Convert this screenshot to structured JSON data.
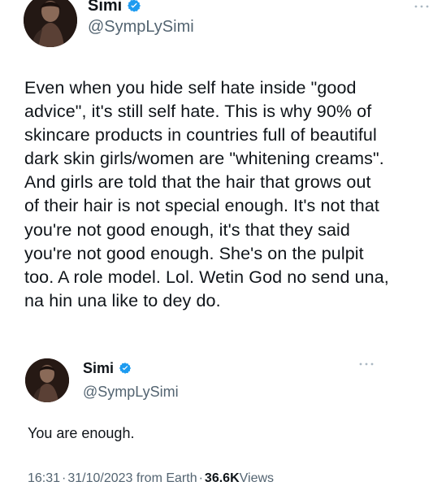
{
  "main_tweet": {
    "author": {
      "display_name": "Simi",
      "handle": "@SympLySimi",
      "verified_icon": "verified-badge-icon",
      "avatar_icon": "avatar"
    },
    "text": "Even when you hide self hate inside \"good\nadvice\", it's still self hate. This is why 90% of\nskincare products in countries full of beautiful\ndark skin girls/women are \"whitening creams\".\nAnd girls are told that the hair that grows out\nof their hair is not special enough. It's not that\nyou're not good enough, it's that they said\nyou're not good enough. She's on the pulpit\ntoo. A role model. Lol. Wetin God no send una,\nna hin una like to dey do.",
    "more_icon": "more-options-icon"
  },
  "quoted_tweet": {
    "author": {
      "display_name": "Simi",
      "handle": "@SympLySimi",
      "verified_icon": "verified-badge-icon",
      "avatar_icon": "avatar"
    },
    "text": "You are enough.",
    "more_icon": "more-options-icon",
    "meta": {
      "time": "16:31",
      "separator": "·",
      "date": "31/10/2023 from Earth",
      "views_count": "36.6K",
      "views_label": "Views"
    }
  },
  "colors": {
    "text": "#0f1419",
    "secondary": "#536471",
    "verified": "#1d9bf0",
    "background": "#ffffff"
  }
}
